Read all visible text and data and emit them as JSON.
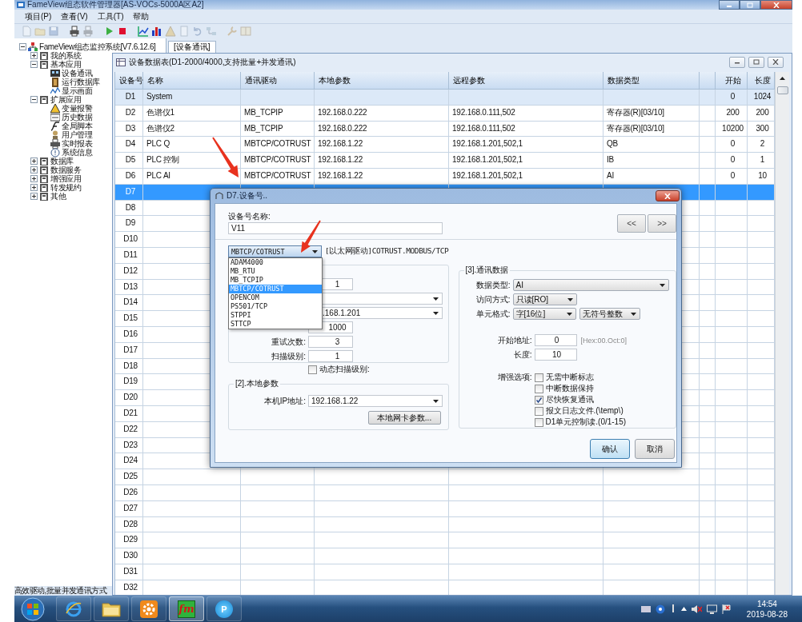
{
  "window": {
    "title": "FameView组态软件管理器[AS-VOCs-5000A区A2]"
  },
  "menu": [
    "项目(P)",
    "查看(V)",
    "工具(T)",
    "帮助"
  ],
  "toolbar": [
    [
      {
        "kind": "new",
        "disabled": true
      },
      {
        "kind": "open",
        "disabled": true
      },
      {
        "kind": "save",
        "disabled": true
      }
    ],
    [
      {
        "kind": "print",
        "disabled": false
      },
      {
        "kind": "preview",
        "disabled": true
      }
    ],
    [
      {
        "kind": "run",
        "disabled": false
      },
      {
        "kind": "stop",
        "disabled": false
      }
    ],
    [
      {
        "kind": "trend",
        "disabled": false
      },
      {
        "kind": "bars",
        "disabled": false
      },
      {
        "kind": "alarm",
        "disabled": true
      },
      {
        "kind": "page",
        "disabled": true
      },
      {
        "kind": "undo",
        "disabled": true
      },
      {
        "kind": "network",
        "disabled": true
      }
    ],
    [
      {
        "kind": "tool",
        "disabled": true
      },
      {
        "kind": "panel",
        "disabled": true
      }
    ]
  ],
  "tree": {
    "label": "FameView组态监控系统[V7.6.12.6]",
    "kind": "root",
    "expanded": true,
    "children": [
      {
        "label": "我的系统",
        "kind": "folder",
        "expanded": false
      },
      {
        "label": "基本应用",
        "kind": "folder",
        "expanded": true,
        "children": [
          {
            "label": "设备通讯",
            "kind": "device"
          },
          {
            "label": "运行数据库",
            "kind": "database"
          },
          {
            "label": "显示画面",
            "kind": "screen"
          }
        ]
      },
      {
        "label": "扩展应用",
        "kind": "folder",
        "expanded": true,
        "children": [
          {
            "label": "变量报警",
            "kind": "alarm"
          },
          {
            "label": "历史数据",
            "kind": "history"
          },
          {
            "label": "全局脚本",
            "kind": "script"
          },
          {
            "label": "用户管理",
            "kind": "user"
          },
          {
            "label": "实时报表",
            "kind": "report"
          },
          {
            "label": "系统信息",
            "kind": "info"
          }
        ]
      },
      {
        "label": "数据库",
        "kind": "folder",
        "expanded": false
      },
      {
        "label": "数据服务",
        "kind": "folder",
        "expanded": false
      },
      {
        "label": "增强应用",
        "kind": "folder",
        "expanded": false
      },
      {
        "label": "转发规约",
        "kind": "folder",
        "expanded": false
      },
      {
        "label": "其他",
        "kind": "folder",
        "expanded": false
      }
    ]
  },
  "tabs": [
    {
      "label": "[设备通讯]",
      "selected": true
    }
  ],
  "table": {
    "title": "设备数据表(D1-2000/4000,支持批量+并发通讯)",
    "columns": [
      "设备号",
      "名称",
      "通讯驱动",
      "本地参数",
      "远程参数",
      "数据类型",
      "开始",
      "长度"
    ],
    "rows": [
      {
        "kind": "system",
        "selected": false,
        "id": "D1",
        "name": "System",
        "start": "0",
        "length": "1024"
      },
      {
        "kind": "device",
        "selected": false,
        "id": "D2",
        "name": "色谱仪1",
        "driver": "MB_TCPIP",
        "local": "192.168.0.222",
        "remote": "192.168.0.111,502",
        "type": "寄存器(R)[03/10]",
        "start": "200",
        "length": "200"
      },
      {
        "kind": "device",
        "selected": false,
        "id": "D3",
        "name": "色谱仪2",
        "driver": "MB_TCPIP",
        "local": "192.168.0.222",
        "remote": "192.168.0.111,502",
        "type": "寄存器(R)[03/10]",
        "start": "10200",
        "length": "300"
      },
      {
        "kind": "device",
        "selected": false,
        "id": "D4",
        "name": "PLC Q",
        "driver": "MBTCP/COTRUST",
        "local": "192.168.1.22",
        "remote": "192.168.1.201,502,1",
        "type": "QB",
        "start": "0",
        "length": "2"
      },
      {
        "kind": "device",
        "selected": false,
        "id": "D5",
        "name": "PLC 控制",
        "driver": "MBTCP/COTRUST",
        "local": "192.168.1.22",
        "remote": "192.168.1.201,502,1",
        "type": "IB",
        "start": "0",
        "length": "1"
      },
      {
        "kind": "device",
        "selected": false,
        "id": "D6",
        "name": "PLC AI",
        "driver": "MBTCP/COTRUST",
        "local": "192.168.1.22",
        "remote": "192.168.1.201,502,1",
        "type": "AI",
        "start": "0",
        "length": "10"
      },
      {
        "kind": "device",
        "selected": true,
        "id": "D7"
      },
      {
        "kind": "device",
        "selected": false,
        "id": "D8"
      },
      {
        "kind": "device",
        "selected": false,
        "id": "D9"
      },
      {
        "kind": "device",
        "selected": false,
        "id": "D10"
      },
      {
        "kind": "device",
        "selected": false,
        "id": "D11"
      },
      {
        "kind": "device",
        "selected": false,
        "id": "D12"
      },
      {
        "kind": "device",
        "selected": false,
        "id": "D13"
      },
      {
        "kind": "device",
        "selected": false,
        "id": "D14"
      },
      {
        "kind": "device",
        "selected": false,
        "id": "D15"
      },
      {
        "kind": "device",
        "selected": false,
        "id": "D16"
      },
      {
        "kind": "device",
        "selected": false,
        "id": "D17"
      },
      {
        "kind": "device",
        "selected": false,
        "id": "D18"
      },
      {
        "kind": "device",
        "selected": false,
        "id": "D19"
      },
      {
        "kind": "device",
        "selected": false,
        "id": "D20"
      },
      {
        "kind": "device",
        "selected": false,
        "id": "D21"
      },
      {
        "kind": "device",
        "selected": false,
        "id": "D22"
      },
      {
        "kind": "device",
        "selected": false,
        "id": "D23"
      },
      {
        "kind": "device",
        "selected": false,
        "id": "D24"
      },
      {
        "kind": "device",
        "selected": false,
        "id": "D25"
      },
      {
        "kind": "device",
        "selected": false,
        "id": "D26"
      },
      {
        "kind": "device",
        "selected": false,
        "id": "D27"
      },
      {
        "kind": "device",
        "selected": false,
        "id": "D28"
      },
      {
        "kind": "device",
        "selected": false,
        "id": "D29"
      },
      {
        "kind": "device",
        "selected": false,
        "id": "D30"
      },
      {
        "kind": "device",
        "selected": false,
        "id": "D31"
      },
      {
        "kind": "device",
        "selected": false,
        "id": "D32"
      }
    ]
  },
  "status": "高效驱动,批量并发通讯方式",
  "dialog": {
    "title": "D7.设备号..",
    "name_label": "设备号名称:",
    "name_value": "V11",
    "nav_buttons": [
      "<<",
      ">>"
    ],
    "driver": {
      "value": "MBTCP/COTRUST",
      "expanded": true,
      "description": "[以太网驱动]COTRUST.MODBUS/TCP",
      "options": [
        {
          "label": "ADAM4000",
          "selected": false
        },
        {
          "label": "MB_RTU",
          "selected": false
        },
        {
          "label": "MB_TCPIP",
          "selected": false
        },
        {
          "label": "MBTCP/COTRUST",
          "selected": true
        },
        {
          "label": "OPENCOM",
          "selected": false
        },
        {
          "label": "PS501/TCP",
          "selected": false
        },
        {
          "label": "STPPI",
          "selected": false
        },
        {
          "label": "STTCP",
          "selected": false
        }
      ]
    },
    "group1": [
      {
        "kind": "input",
        "value": "1"
      },
      {
        "kind": "select"
      },
      {
        "kind": "select",
        "value": ".168.1.201"
      },
      {
        "kind": "input",
        "value": "1000"
      },
      {
        "kind": "input",
        "label": "重试次数:",
        "value": "3"
      },
      {
        "kind": "input",
        "label": "扫描级别:",
        "value": "1"
      },
      {
        "kind": "checkbox",
        "label": "动态扫描级别:",
        "checked": false
      }
    ],
    "group2": {
      "title": "[2].本地参数",
      "ip_label": "本机IP地址:",
      "ip_value": "192.168.1.22",
      "button": "本地网卡参数..."
    },
    "group3": {
      "title": "[3].通讯数据",
      "data_type": {
        "label": "数据类型:",
        "value": "AI"
      },
      "access": {
        "label": "访问方式:",
        "value": "只读[RO]"
      },
      "format": {
        "label": "单元格式:",
        "values": [
          "字[16位]",
          "无符号整数"
        ]
      },
      "start": {
        "label": "开始地址:",
        "value": "0",
        "hint": "[Hex:00.Oct:0]"
      },
      "length": {
        "label": "长度:",
        "value": "10"
      },
      "options_label": "增强选项:",
      "options": [
        {
          "label": "无需中断标志",
          "checked": false
        },
        {
          "label": "中断数据保持",
          "checked": false
        },
        {
          "label": "尽快恢复通讯",
          "checked": true
        },
        {
          "label": "报文日志文件.(\\temp\\)",
          "checked": false
        },
        {
          "label": "D1单元控制读.(0/1-15)",
          "checked": false
        }
      ]
    },
    "buttons": [
      {
        "label": "确认",
        "default": true
      },
      {
        "label": "取消",
        "default": false
      }
    ]
  },
  "taskbar": {
    "apps": [
      {
        "kind": "browser",
        "active": false
      },
      {
        "kind": "folder",
        "active": false
      },
      {
        "kind": "gear",
        "active": false
      },
      {
        "kind": "fm",
        "label": "fm",
        "active": true
      },
      {
        "kind": "p",
        "label": "P",
        "active": false
      }
    ],
    "time": "14:54",
    "date": "2019-08-28"
  }
}
